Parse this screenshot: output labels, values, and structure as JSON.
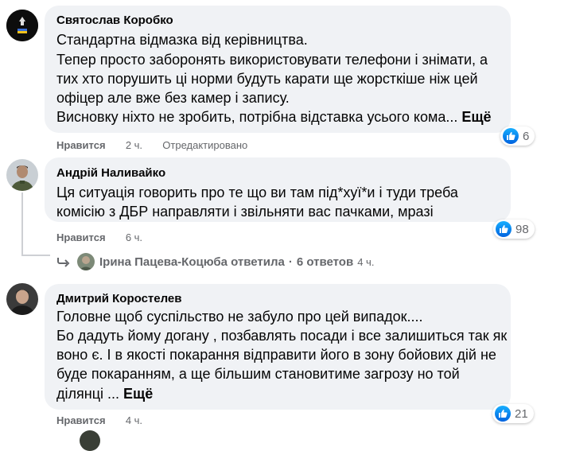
{
  "colors": {
    "bubble": "#f0f2f5",
    "meta": "#65676b",
    "like_blue": "#1877f2",
    "text": "#050505"
  },
  "comments": [
    {
      "author": "Святослав Коробко",
      "lines": [
        "Стандартна відмазка від керівництва.",
        "Тепер просто заборонять використовувати телефони і знімати, а",
        "тих хто порушить ці норми будуть карати ще жорсткіше ніж цей",
        "офіцер але вже без камер і запису.",
        "Висновку ніхто не зробить, потрібна відставка усього кома..."
      ],
      "see_more": "Ещё",
      "like_label": "Нравится",
      "time": "2 ч.",
      "edited": "Отредактировано",
      "reactions_count": "6"
    },
    {
      "author": "Андрій Наливайко",
      "lines": [
        "Ця ситуація говорить про те що ви там під*хуї*и і туди треба",
        "комісію з ДБР направляти і звільняти вас пачками, мразі"
      ],
      "like_label": "Нравится",
      "time": "6 ч.",
      "reactions_count": "98",
      "reply": {
        "replier": "Ірина Пацева-Коцюба ответила",
        "separator": "·",
        "count": "6 ответов",
        "time": "4 ч."
      }
    },
    {
      "author": "Дмитрий Коростелев",
      "lines": [
        "Головне щоб суспільство не забуло про цей випадок....",
        "Бо дадуть йому догану , позбавлять посади і все залишиться так як",
        "воно є. І в якості покарання відправити його в зону бойових дій не",
        "буде покаранням, а ще більшим становитиме загрозу но той",
        "ділянці ..."
      ],
      "see_more": "Ещё",
      "like_label": "Нравится",
      "time": "4 ч.",
      "reactions_count": "21"
    }
  ]
}
